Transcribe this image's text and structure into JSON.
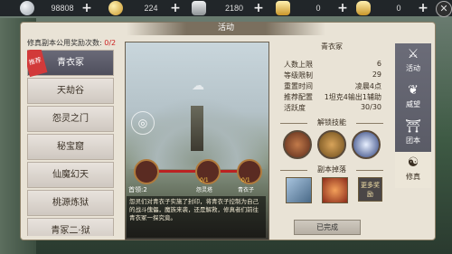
{
  "currencies": [
    {
      "icon": "silver-coin-icon",
      "value": "98808",
      "color": "#c9ced3"
    },
    {
      "icon": "gold-coin-icon",
      "value": "224",
      "color": "#e7bd4a"
    },
    {
      "icon": "ingot-icon",
      "value": "2180",
      "color": "#bfc3c5"
    },
    {
      "icon": "gold-ingot-icon",
      "value": "0",
      "color": "#e8c152"
    },
    {
      "icon": "yuanbao-icon",
      "value": "0",
      "color": "#e9c257"
    }
  ],
  "panel": {
    "title": "活动",
    "reward_label": "修真副本公用奖励次数:",
    "reward_count": "0/2"
  },
  "dungeon_list": [
    {
      "label": "青衣冢",
      "selected": true,
      "tag": "推荐"
    },
    {
      "label": "天劫谷"
    },
    {
      "label": "怨灵之门"
    },
    {
      "label": "秘宝窟"
    },
    {
      "label": "仙魔幻天"
    },
    {
      "label": "桃源炼狱"
    },
    {
      "label": "青冢二·狱"
    }
  ],
  "picture": {
    "first_kill": "首领:2",
    "bosses": [
      {
        "label": "青衣子"
      },
      {
        "label": "怨灵塔",
        "progress": "0/1"
      },
      {
        "label": "青衣子",
        "progress": "0/1"
      }
    ],
    "description": "怨灵们对青衣子实施了封印，将青衣子控制为自己的战斗傀儡，魔族来袭，还是解救，修真者们前往青衣冢一探究竟。"
  },
  "info": {
    "name": "青衣冢",
    "rows": [
      {
        "k": "人数上限",
        "v": "6"
      },
      {
        "k": "等级限制",
        "v": "29"
      },
      {
        "k": "重置时间",
        "v": "凌晨4点"
      },
      {
        "k": "推荐配置",
        "v": "1坦克4输出1辅助"
      },
      {
        "k": "活跃度",
        "v": "30/30"
      }
    ],
    "skills_title": "解锁技能",
    "skills": [
      {
        "icon": "fist-skill-icon",
        "color": "#8a4a2a"
      },
      {
        "icon": "claw-skill-icon",
        "color": "#b07a3a"
      },
      {
        "icon": "vortex-skill-icon",
        "color": "#2a3e7a"
      }
    ],
    "drops_title": "副本掉落",
    "drops": [
      {
        "icon": "scroll-item-icon",
        "color": "#6a8aa8"
      },
      {
        "icon": "egg-item-icon",
        "color": "#d8623a"
      }
    ],
    "more_label": "更多奖励",
    "done_label": "已完成"
  },
  "tabs": [
    {
      "icon": "activity-icon",
      "label": "活动"
    },
    {
      "icon": "prestige-icon",
      "label": "威望"
    },
    {
      "icon": "team-icon",
      "label": "团本"
    },
    {
      "icon": "cultivation-icon",
      "label": "修真",
      "selected": true
    }
  ]
}
